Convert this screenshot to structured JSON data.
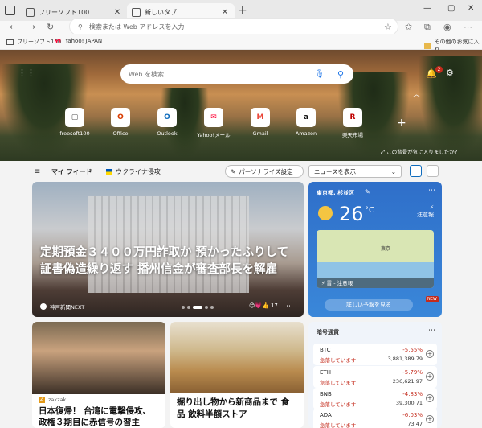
{
  "tabs": [
    {
      "title": "フリーソフト100"
    },
    {
      "title": "新しいタブ"
    }
  ],
  "address": {
    "placeholder": "検索または Web アドレスを入力"
  },
  "favorites": [
    {
      "label": "フリーソフト100"
    },
    {
      "label": "Yahoo! JAPAN"
    },
    {
      "label": "その他のお気に入り"
    }
  ],
  "hero": {
    "search_placeholder": "Web を検索",
    "notif_count": "2",
    "like_bg": "この背景が気に入りましたか?",
    "quicklinks": [
      {
        "label": "freesoft100",
        "glyph": "▢",
        "color": "#555555"
      },
      {
        "label": "Office",
        "glyph": "O",
        "color": "#d83b01"
      },
      {
        "label": "Outlook",
        "glyph": "O",
        "color": "#0f6cbd"
      },
      {
        "label": "Yahoo!メール",
        "glyph": "✉",
        "color": "#ff0033"
      },
      {
        "label": "Gmail",
        "glyph": "M",
        "color": "#ea4335"
      },
      {
        "label": "Amazon",
        "glyph": "a",
        "color": "#111111"
      },
      {
        "label": "楽天市場",
        "glyph": "R",
        "color": "#bf0000"
      }
    ]
  },
  "feednav": {
    "myfeed": "マイ フィード",
    "ukraine": "ウクライナ侵攻",
    "personalize": "パーソナライズ設定",
    "news_display": "ニュースを表示"
  },
  "main_article": {
    "headline": "定期預金３４００万円詐取か 預かったふりして証書偽造繰り返す 播州信金が審査部長を解雇",
    "source": "神戸新聞NEXT",
    "reactions": "17"
  },
  "weather": {
    "location": "東京都, 杉並区",
    "temp": "26",
    "unit": "°C",
    "alert_label": "注意報",
    "map_label": "東京",
    "warning": "雷 - 注意報",
    "forecast_button": "詳しい予報を見る",
    "new_badge": "NEW"
  },
  "cards": [
    {
      "source": "zakzak",
      "title": "日本復帰！ 台湾に電撃侵攻、政権３期目に赤信号の習主"
    },
    {
      "title": "掘り出し物から新商品まで 食品 飲料半額ストア"
    }
  ],
  "crypto": {
    "header": "暗号通貨",
    "rows": [
      {
        "name": "BTC",
        "status": "急落しています",
        "pct": "-5.55%",
        "price": "3,881,389.79"
      },
      {
        "name": "ETH",
        "status": "急落しています",
        "pct": "-5.79%",
        "price": "236,621.97"
      },
      {
        "name": "BNB",
        "status": "急落しています",
        "pct": "-4.83%",
        "price": "39,300.71"
      },
      {
        "name": "ADA",
        "status": "急落しています",
        "pct": "-6.03%",
        "price": "73.47"
      }
    ]
  }
}
